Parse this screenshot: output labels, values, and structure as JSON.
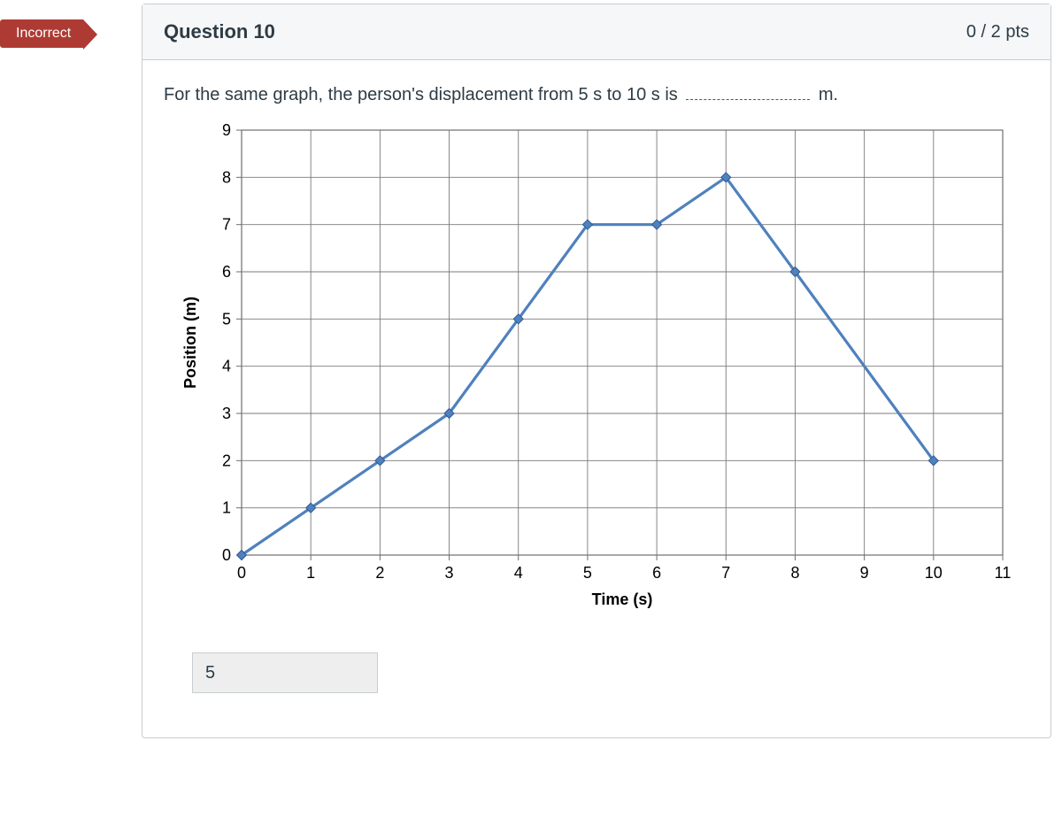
{
  "status_badge": "Incorrect",
  "header": {
    "title": "Question 10",
    "points": "0 / 2 pts"
  },
  "prompt": {
    "pre": "For the same graph, the person's displacement from 5 s to 10 s is ",
    "post": " m."
  },
  "answer": {
    "value": "5"
  },
  "chart_data": {
    "type": "line",
    "xlabel": "Time (s)",
    "ylabel": "Position (m)",
    "xlim": [
      0,
      11
    ],
    "ylim": [
      0,
      9
    ],
    "x_ticks": [
      0,
      1,
      2,
      3,
      4,
      5,
      6,
      7,
      8,
      9,
      10,
      11
    ],
    "y_ticks": [
      0,
      1,
      2,
      3,
      4,
      5,
      6,
      7,
      8,
      9
    ],
    "series": [
      {
        "name": "position",
        "color": "#4F81BD",
        "x": [
          0,
          1,
          2,
          3,
          4,
          5,
          6,
          7,
          8,
          10
        ],
        "y": [
          0,
          1,
          2,
          3,
          5,
          7,
          7,
          8,
          6,
          2
        ]
      }
    ]
  }
}
